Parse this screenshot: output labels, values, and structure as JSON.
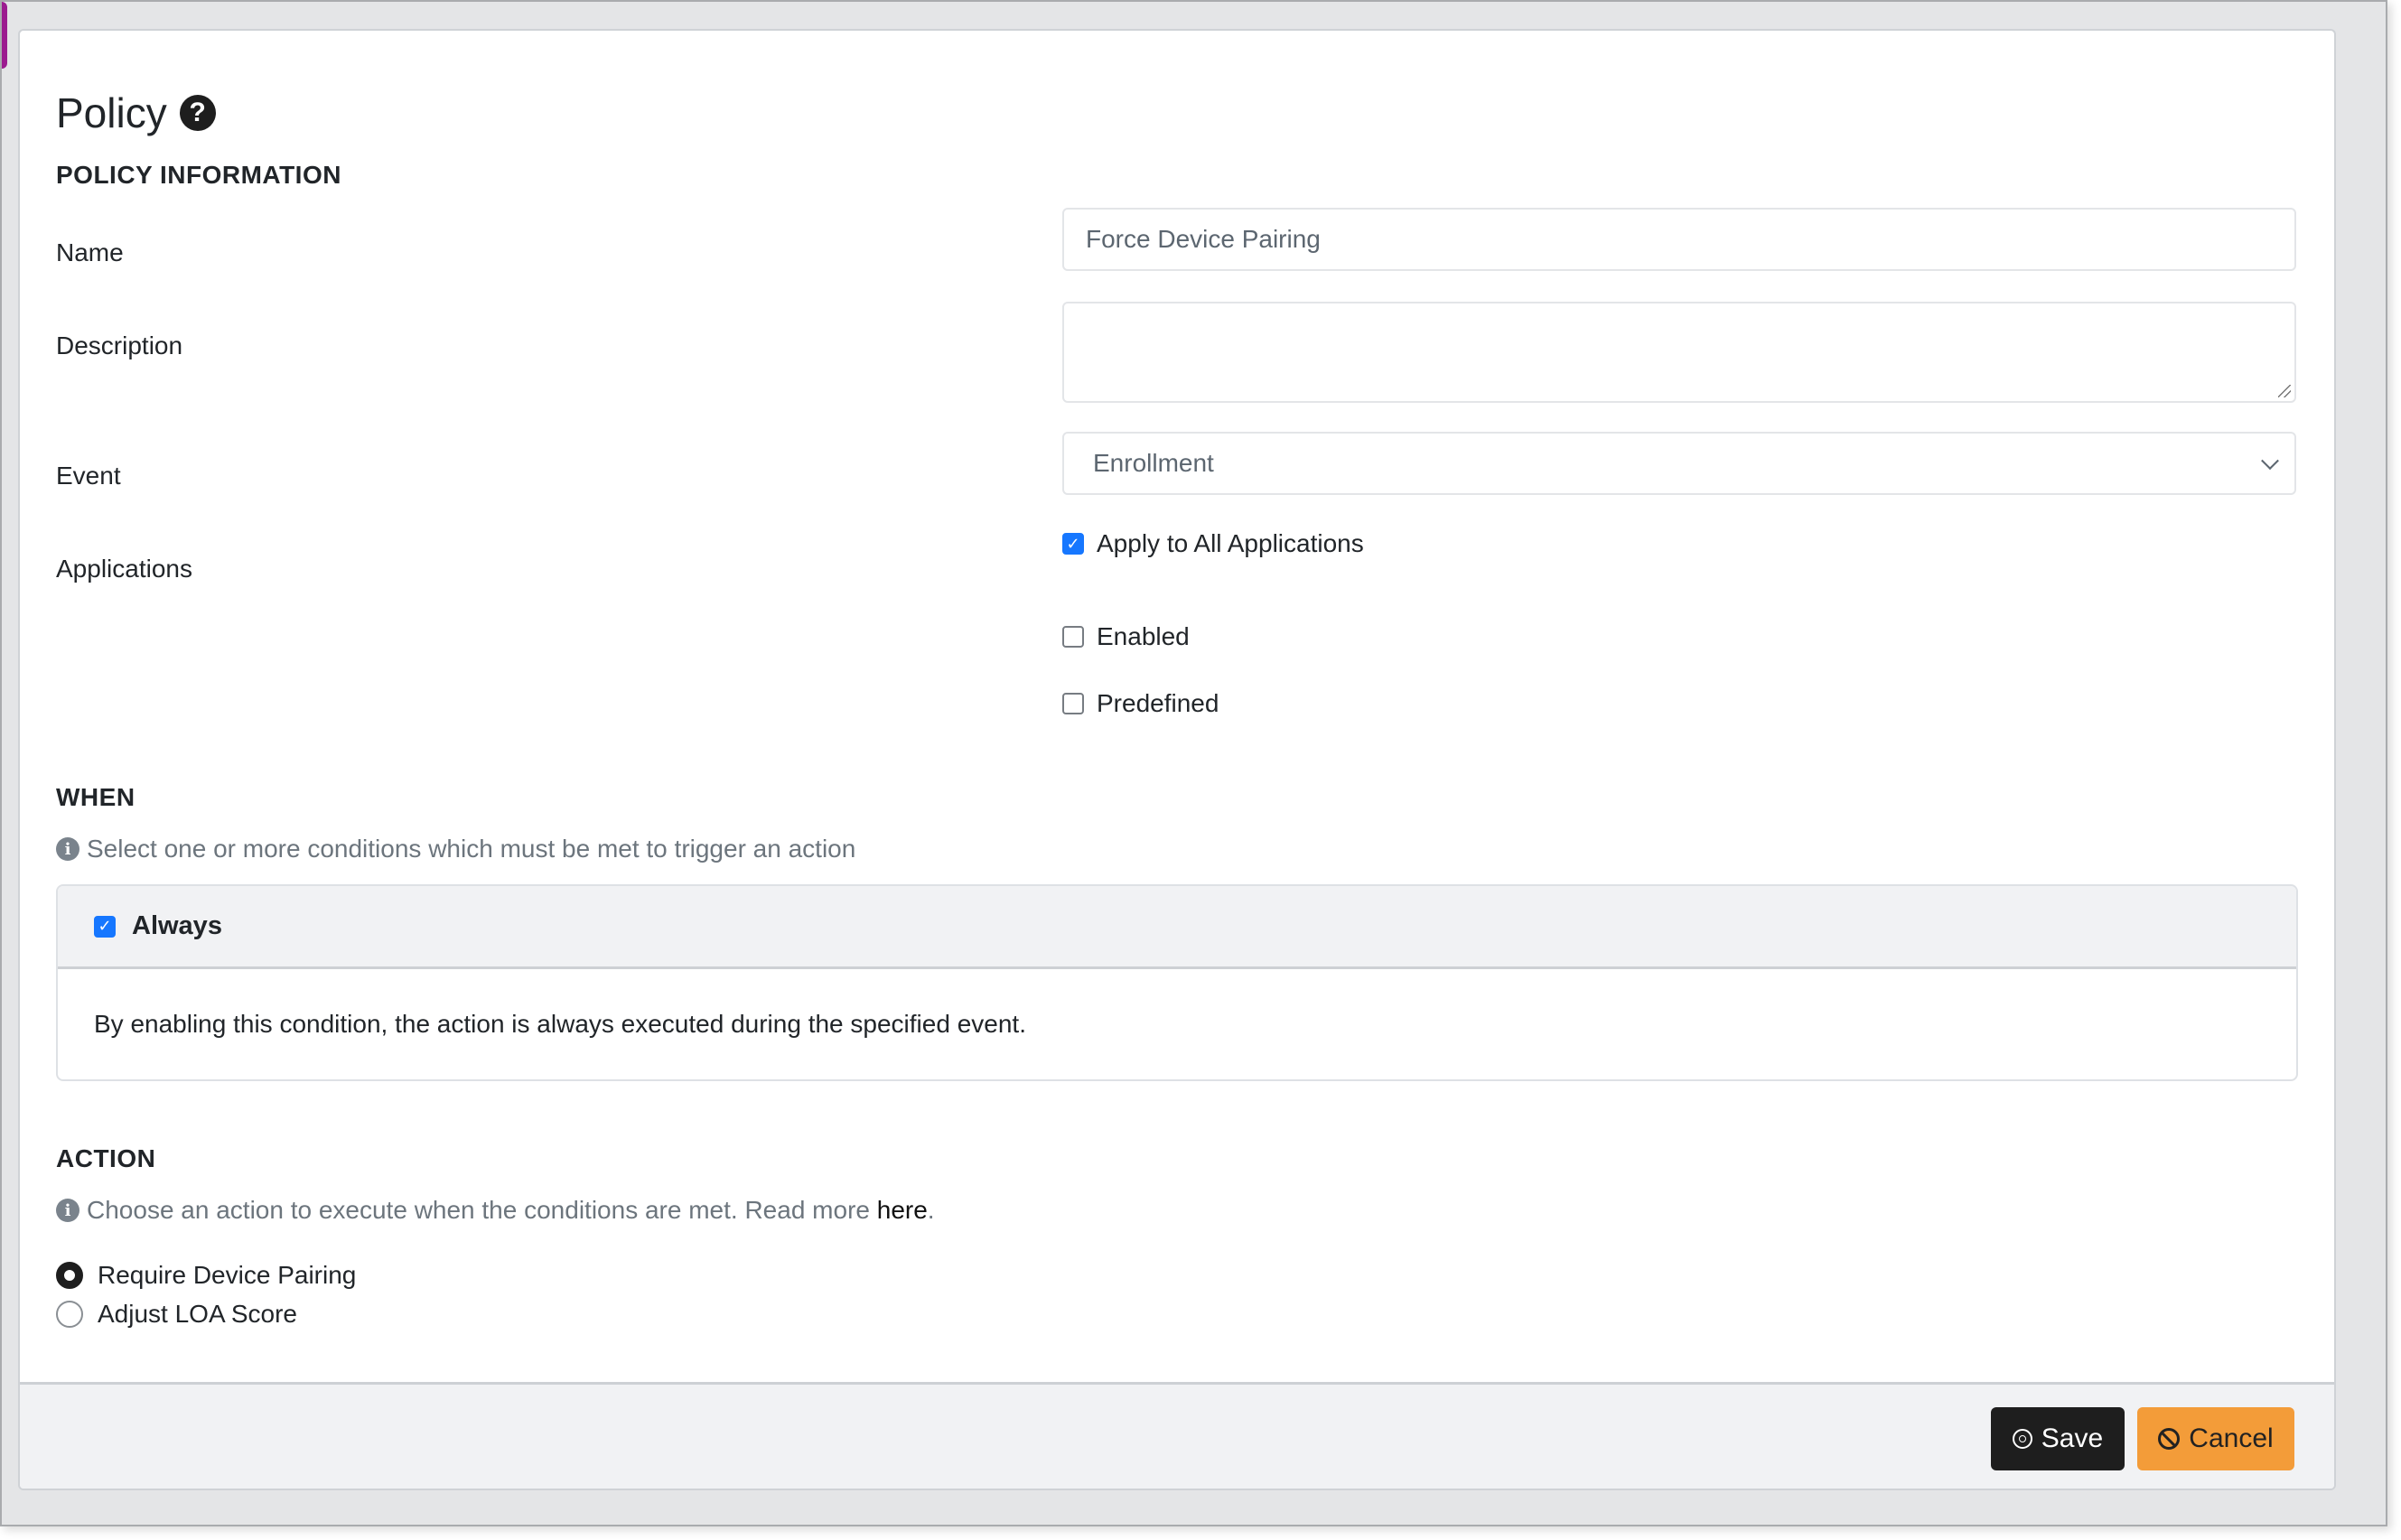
{
  "page": {
    "title": "Policy",
    "colors": {
      "accent_checkbox": "#1677ff",
      "save_button": "#1e1e1e",
      "cancel_button": "#f39c39",
      "sidebar_accent": "#9b1c8f"
    }
  },
  "policy_information": {
    "heading": "POLICY INFORMATION",
    "name": {
      "label": "Name",
      "value": "Force Device Pairing"
    },
    "description": {
      "label": "Description",
      "value": ""
    },
    "event": {
      "label": "Event",
      "selected": "Enrollment"
    },
    "applications": {
      "label": "Applications",
      "apply_all": {
        "label": "Apply to All Applications",
        "checked": true
      }
    },
    "enabled": {
      "label": "Enabled",
      "checked": false
    },
    "predefined": {
      "label": "Predefined",
      "checked": false
    }
  },
  "when": {
    "heading": "WHEN",
    "info": "Select one or more conditions which must be met to trigger an action",
    "condition": {
      "label": "Always",
      "checked": true,
      "description": "By enabling this condition, the action is always executed during the specified event."
    }
  },
  "action": {
    "heading": "ACTION",
    "info": "Choose an action to execute when the conditions are met. Read more ",
    "info_link": "here",
    "info_suffix": ".",
    "options": [
      {
        "label": "Require Device Pairing",
        "selected": true
      },
      {
        "label": "Adjust LOA Score",
        "selected": false
      }
    ]
  },
  "footer": {
    "save_label": "Save",
    "cancel_label": "Cancel"
  }
}
